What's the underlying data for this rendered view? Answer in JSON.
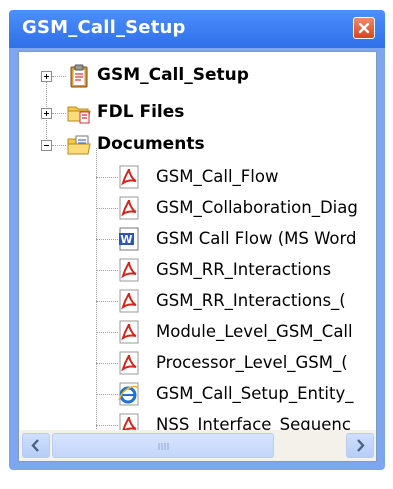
{
  "window": {
    "title": "GSM_Call_Setup"
  },
  "tree": {
    "nodes": [
      {
        "label": "GSM_Call_Setup",
        "icon": "clipboard-icon",
        "expander": "+"
      },
      {
        "label": "FDL Files",
        "icon": "folder-icon",
        "expander": "+"
      },
      {
        "label": "Documents",
        "icon": "documents-folder-icon",
        "expander": "-"
      }
    ],
    "documents": [
      {
        "label": "GSM_Call_Flow",
        "icon": "pdf-icon"
      },
      {
        "label": "GSM_Collaboration_Diag",
        "icon": "pdf-icon"
      },
      {
        "label": "GSM Call Flow (MS Word",
        "icon": "word-doc-icon"
      },
      {
        "label": "GSM_RR_Interactions",
        "icon": "pdf-icon"
      },
      {
        "label": "GSM_RR_Interactions_(",
        "icon": "pdf-icon"
      },
      {
        "label": "Module_Level_GSM_Call",
        "icon": "pdf-icon"
      },
      {
        "label": "Processor_Level_GSM_(",
        "icon": "pdf-icon"
      },
      {
        "label": "GSM_Call_Setup_Entity_",
        "icon": "ie-html-icon"
      },
      {
        "label": "NSS_Interface_Sequenc",
        "icon": "pdf-icon"
      }
    ]
  },
  "colors": {
    "titlebar": "#2f6fe8",
    "close_button": "#d9431f",
    "pdf_red": "#d4251c",
    "folder_yellow": "#f5c84a"
  }
}
